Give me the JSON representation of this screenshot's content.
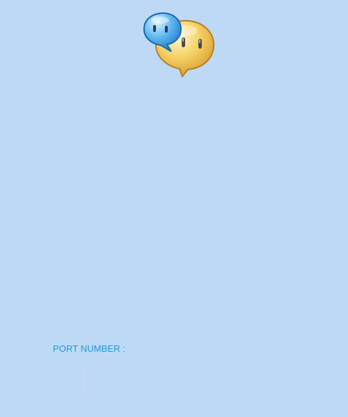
{
  "app": {
    "logo_icon": "chat-bubbles-icon",
    "background_color": "#bed9f6"
  },
  "form": {
    "port_label": "PORT NUMBER :",
    "port_value": "",
    "label_color": "#1a9ad6"
  }
}
